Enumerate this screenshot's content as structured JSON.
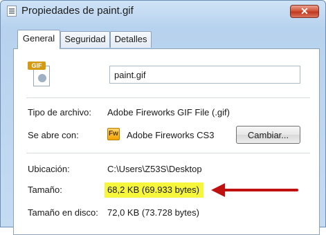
{
  "window": {
    "title": "Propiedades de paint.gif",
    "close_glyph": "✕",
    "title_icon": "document-icon"
  },
  "tabs": [
    {
      "label": "General",
      "active": true
    },
    {
      "label": "Seguridad",
      "active": false
    },
    {
      "label": "Detalles",
      "active": false
    }
  ],
  "file": {
    "icon": "gif-file-icon",
    "icon_badge": "GIF",
    "name": "paint.gif"
  },
  "properties": {
    "type": {
      "label": "Tipo de archivo:",
      "value": "Adobe Fireworks GIF File (.gif)"
    },
    "opens_with": {
      "label": "Se abre con:",
      "value": "Adobe Fireworks CS3",
      "app_icon_text": "Fw",
      "change_button": "Cambiar..."
    },
    "location": {
      "label": "Ubicación:",
      "value": "C:\\Users\\Z53S\\Desktop"
    },
    "size": {
      "label": "Tamaño:",
      "value": "68,2 KB (69.933 bytes)"
    },
    "size_on_disk": {
      "label": "Tamaño en disco:",
      "value": "72,0 KB (73.728 bytes)"
    }
  },
  "colors": {
    "highlight": "#f6f63c",
    "arrow": "#c01010",
    "close_button": "#c0391f"
  }
}
